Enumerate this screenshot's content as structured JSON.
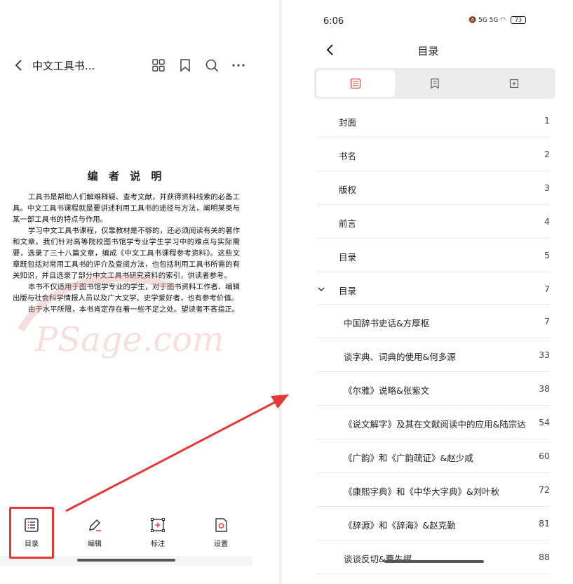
{
  "reader": {
    "book_title": "中文工具书...",
    "doc_title": "编 者 说 明",
    "paragraphs": [
      "工具书是帮助人们解难释疑、查考文献，并获得资料线索的必备工具。中文工具书课程就是要讲述利用工具书的途径与方法，阐明某类与某一部工具书的特点与作用。",
      "学习中文工具书课程，仅靠教材是不够的，还必须阅读有关的著作和文章。我们针对高等院校图书馆学专业学生学习中的难点与实际需要，选录了三十八篇文章，编成《中文工具书课程参考资料》。这些文章既包括对常用工具书的评介及查阅方法，也包括利用工具书所需的有关知识，并且选录了部分中文工具书研究资料的索引，供读者参考。",
      "本书不仅适用于图书馆学专业的学生，对于图书资料工作者、编辑出版与社会科学情报人员以及广大文学、史学爱好者，也有参考价值。",
      "由于水平所限，本书肯定存在着一些不足之处。望读者不吝指正。"
    ],
    "bottom_bar": [
      {
        "label": "目录",
        "icon": "toc-icon"
      },
      {
        "label": "编辑",
        "icon": "edit-pen-icon"
      },
      {
        "label": "标注",
        "icon": "annotate-icon"
      },
      {
        "label": "设置",
        "icon": "settings-icon"
      }
    ]
  },
  "status_bar": {
    "time": "6:06",
    "signal": "5G 5G",
    "battery": "73"
  },
  "toc": {
    "title": "目录",
    "tabs": [
      {
        "icon": "list-icon",
        "active": true
      },
      {
        "icon": "bookmark-icon",
        "active": false
      },
      {
        "icon": "annotation-icon",
        "active": false
      }
    ],
    "items": [
      {
        "label": "封面",
        "page": "1"
      },
      {
        "label": "书名",
        "page": "2"
      },
      {
        "label": "版权",
        "page": "3"
      },
      {
        "label": "前言",
        "page": "4"
      },
      {
        "label": "目录",
        "page": "5"
      },
      {
        "label": "目录",
        "page": "7",
        "expanded": true
      },
      {
        "label": "中国辞书史话&方厚枢",
        "page": "7",
        "child": true
      },
      {
        "label": "谈字典、词典的使用&何多源",
        "page": "33",
        "child": true
      },
      {
        "label": "《尔雅》说略&张紫文",
        "page": "38",
        "child": true
      },
      {
        "label": "《说文解字》及其在文献阅读中的应用&陆宗达",
        "page": "54",
        "child": true
      },
      {
        "label": "《广韵》和《广韵疏证》&赵少咸",
        "page": "60",
        "child": true
      },
      {
        "label": "《康熙字典》和《中华大字典》&刘叶秋",
        "page": "72",
        "child": true
      },
      {
        "label": "《辞源》和《辞海》&赵克勤",
        "page": "81",
        "child": true
      },
      {
        "label": "谈谈反切&曹先擢",
        "page": "88",
        "child": true
      }
    ]
  },
  "colors": {
    "highlight": "#e53935",
    "tab_bg": "#ececec"
  }
}
